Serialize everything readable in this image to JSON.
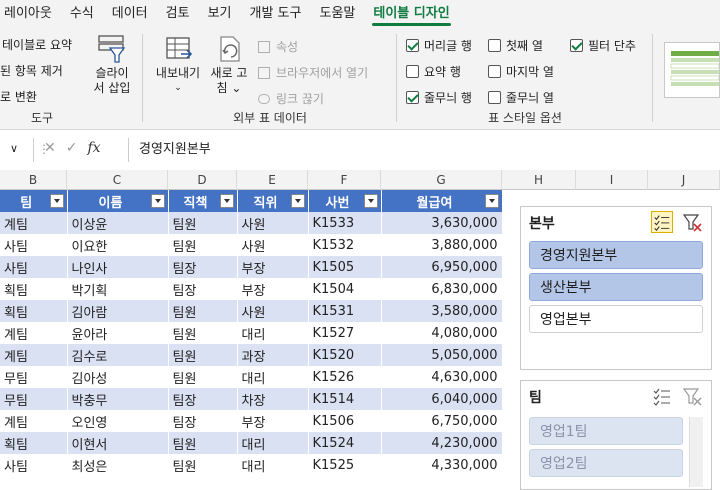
{
  "ribbon_tabs": [
    "레이아웃",
    "수식",
    "데이터",
    "검토",
    "보기",
    "개발 도구",
    "도움말",
    "테이블 디자인"
  ],
  "ribbon": {
    "tools": {
      "summarize": "테이블로 요약",
      "remove_dupes": "된 항목 제거",
      "convert": "로 변환",
      "slicer_line1": "슬라이",
      "slicer_line2": "서 삽입",
      "title": "도구"
    },
    "external": {
      "export_label": "내보내기",
      "refresh_line1": "새로 고",
      "refresh_line2": "침",
      "properties": "속성",
      "open_browser": "브라우저에서 열기",
      "unlink": "링크 끊기",
      "title": "외부 표 데이터"
    },
    "style_options": {
      "header_row": "머리글 행",
      "total_row": "요약 행",
      "banded_rows": "줄무늬 행",
      "first_column": "첫째 열",
      "last_column": "마지막 열",
      "banded_columns": "줄무늬 열",
      "filter_button": "필터 단추",
      "title": "표 스타일 옵션"
    }
  },
  "formula_bar": {
    "namebox_chevron": "∨",
    "fx": "fx",
    "value": "경영지원본부"
  },
  "column_letters": [
    "B",
    "C",
    "D",
    "E",
    "F",
    "G",
    "H",
    "I",
    "J"
  ],
  "table": {
    "headers": [
      "팀",
      "이름",
      "직책",
      "직위",
      "사번",
      "월급여"
    ],
    "rows": [
      [
        "계팀",
        "이상윤",
        "팀원",
        "사원",
        "K1533",
        "3,630,000"
      ],
      [
        "사팀",
        "이요한",
        "팀원",
        "사원",
        "K1532",
        "3,880,000"
      ],
      [
        "사팀",
        "나인사",
        "팀장",
        "부장",
        "K1505",
        "6,950,000"
      ],
      [
        "획팀",
        "박기획",
        "팀장",
        "부장",
        "K1504",
        "6,830,000"
      ],
      [
        "획팀",
        "김아람",
        "팀원",
        "사원",
        "K1531",
        "3,580,000"
      ],
      [
        "계팀",
        "윤아라",
        "팀원",
        "대리",
        "K1527",
        "4,080,000"
      ],
      [
        "계팀",
        "김수로",
        "팀원",
        "과장",
        "K1520",
        "5,050,000"
      ],
      [
        "무팀",
        "김아성",
        "팀원",
        "대리",
        "K1526",
        "4,630,000"
      ],
      [
        "무팀",
        "박충무",
        "팀장",
        "차장",
        "K1514",
        "6,040,000"
      ],
      [
        "계팀",
        "오인영",
        "팀장",
        "부장",
        "K1506",
        "6,750,000"
      ],
      [
        "획팀",
        "이현서",
        "팀원",
        "대리",
        "K1524",
        "4,230,000"
      ],
      [
        "사팀",
        "최성은",
        "팀원",
        "대리",
        "K1525",
        "4,330,000"
      ]
    ]
  },
  "slicer_bonbu": {
    "title": "본부",
    "items": [
      "경영지원본부",
      "생산본부",
      "영업본부"
    ]
  },
  "slicer_team": {
    "title": "팀",
    "items": [
      "영업1팀",
      "영업2팀"
    ]
  },
  "colors": {
    "accent": "#107c41",
    "table_header": "#4472c4",
    "band": "#d9e1f2",
    "slicer_selected": "#b4c6e7"
  }
}
